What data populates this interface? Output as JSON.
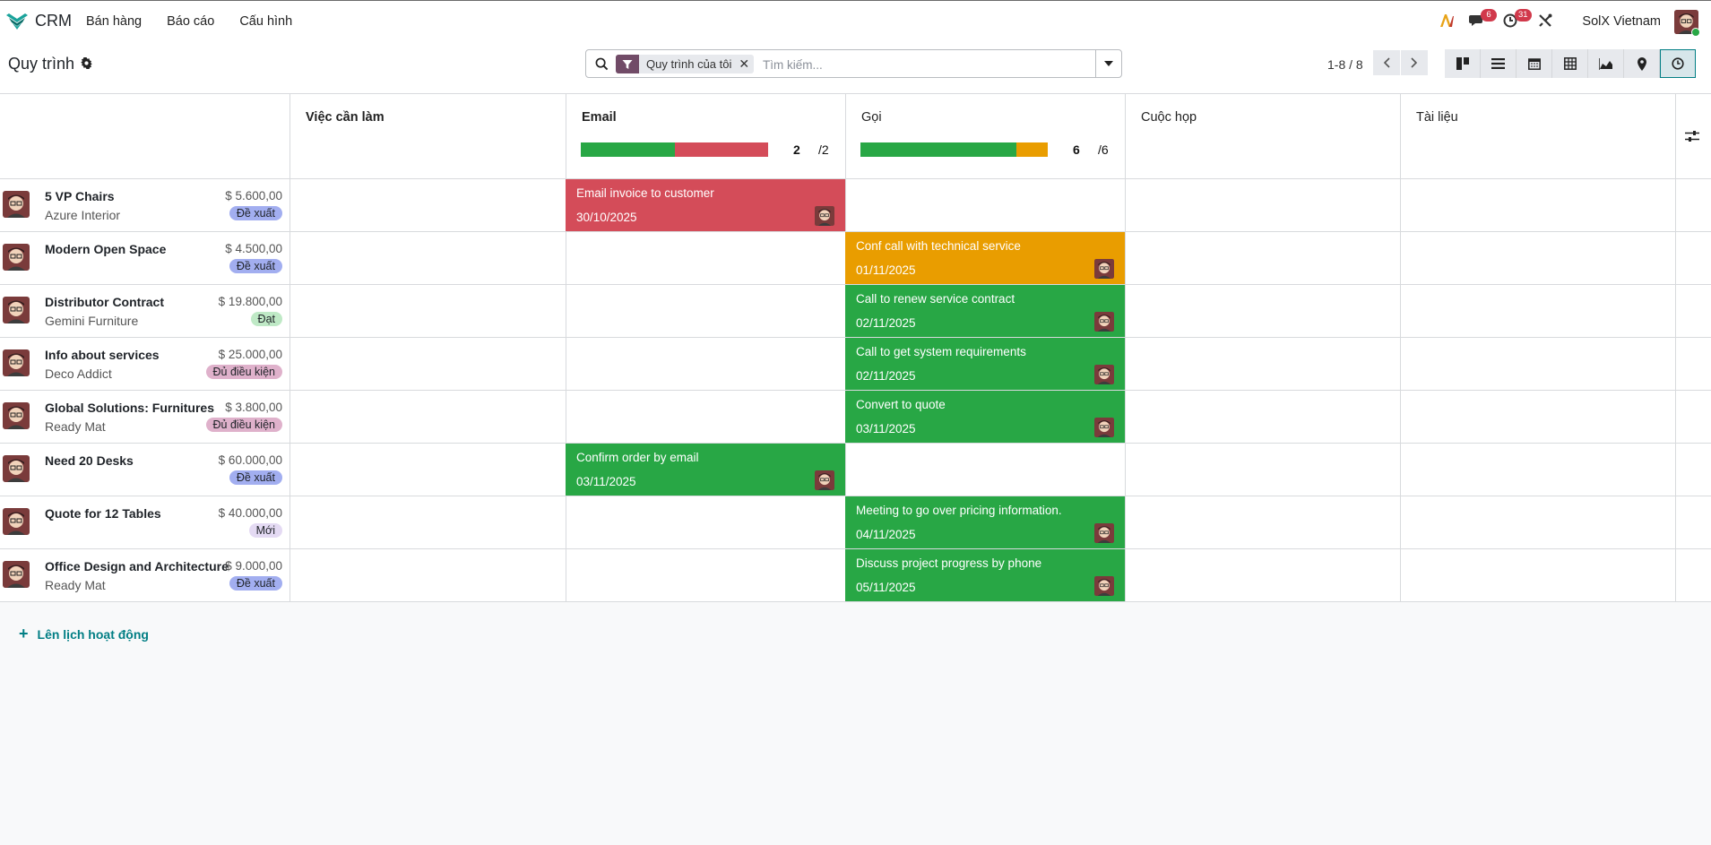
{
  "nav": {
    "app_name": "CRM",
    "menu": [
      "Bán hàng",
      "Báo cáo",
      "Cấu hình"
    ],
    "messages_count": "6",
    "activities_count": "31",
    "company": "SolX Vietnam"
  },
  "control": {
    "page_title": "Quy trình",
    "facet_label": "Quy trình của tôi",
    "search_placeholder": "Tìm kiếm...",
    "pager": "1-8 / 8"
  },
  "columns": [
    {
      "title": "Việc cần làm"
    },
    {
      "title": "Email",
      "count": "2",
      "total": "/2",
      "progress": [
        {
          "color": "#28a745",
          "fraction": 0.5
        },
        {
          "color": "#d44c59",
          "fraction": 0.5
        }
      ]
    },
    {
      "title": "Gọi",
      "count": "6",
      "total": "/6",
      "progress": [
        {
          "color": "#28a745",
          "fraction": 0.833
        },
        {
          "color": "#e99d00",
          "fraction": 0.167
        }
      ]
    },
    {
      "title": "Cuộc họp"
    },
    {
      "title": "Tài liệu"
    }
  ],
  "records": [
    {
      "name": "5 VP Chairs",
      "company": "Azure Interior",
      "amount": "$ 5.600,00",
      "tag": "Đề xuất",
      "tag_color": "#a2aef0",
      "activity": {
        "col": 1,
        "title": "Email invoice to customer",
        "date": "30/10/2025",
        "color": "#d44c59"
      }
    },
    {
      "name": "Modern Open Space",
      "company": "",
      "amount": "$ 4.500,00",
      "tag": "Đề xuất",
      "tag_color": "#a2aef0",
      "activity": {
        "col": 2,
        "title": "Conf call with technical service",
        "date": "01/11/2025",
        "color": "#e99d00"
      }
    },
    {
      "name": "Distributor Contract",
      "company": "Gemini Furniture",
      "amount": "$ 19.800,00",
      "tag": "Đạt",
      "tag_color": "#bfe9c6",
      "activity": {
        "col": 2,
        "title": "Call to renew service contract",
        "date": "02/11/2025",
        "color": "#28a745"
      }
    },
    {
      "name": "Info about services",
      "company": "Deco Addict",
      "amount": "$ 25.000,00",
      "tag": "Đủ điều kiện",
      "tag_color": "#dfb1cb",
      "activity": {
        "col": 2,
        "title": "Call to get system requirements",
        "date": "02/11/2025",
        "color": "#28a745"
      }
    },
    {
      "name": "Global Solutions: Furnitures",
      "company": "Ready Mat",
      "amount": "$ 3.800,00",
      "tag": "Đủ điều kiện",
      "tag_color": "#dfb1cb",
      "activity": {
        "col": 2,
        "title": "Convert to quote",
        "date": "03/11/2025",
        "color": "#28a745"
      }
    },
    {
      "name": "Need 20 Desks",
      "company": "",
      "amount": "$ 60.000,00",
      "tag": "Đề xuất",
      "tag_color": "#a2aef0",
      "activity": {
        "col": 1,
        "title": "Confirm order by email",
        "date": "03/11/2025",
        "color": "#28a745"
      }
    },
    {
      "name": "Quote for 12 Tables",
      "company": "",
      "amount": "$ 40.000,00",
      "tag": "Mới",
      "tag_color": "#e4daf3",
      "activity": {
        "col": 2,
        "title": "Meeting to go over pricing information.",
        "date": "04/11/2025",
        "color": "#28a745"
      }
    },
    {
      "name": "Office Design and Architecture",
      "company": "Ready Mat",
      "amount": "$ 9.000,00",
      "tag": "Đề xuất",
      "tag_color": "#a2aef0",
      "activity": {
        "col": 2,
        "title": "Discuss project progress by phone",
        "date": "05/11/2025",
        "color": "#28a745"
      }
    }
  ],
  "schedule_label": "Lên lịch hoạt động",
  "colors": {
    "accent": "#017e84",
    "brand": "#714b67"
  }
}
